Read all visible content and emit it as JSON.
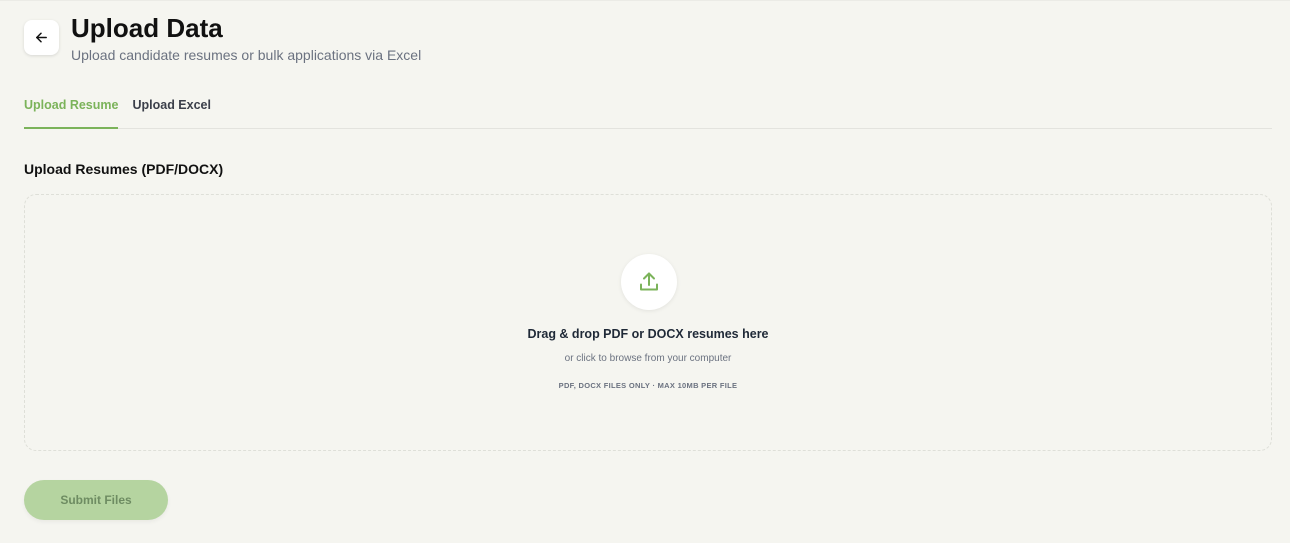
{
  "header": {
    "title": "Upload Data",
    "subtitle": "Upload candidate resumes or bulk applications via Excel",
    "back_icon": "arrow-left-icon"
  },
  "tabs": [
    {
      "label": "Upload Resume",
      "active": true
    },
    {
      "label": "Upload Excel",
      "active": false
    }
  ],
  "section": {
    "title": "Upload Resumes (PDF/DOCX)"
  },
  "dropzone": {
    "icon": "upload-icon",
    "primary_text": "Drag & drop PDF or DOCX resumes here",
    "secondary_text": "or click to browse from your computer",
    "hint_text": "PDF, DOCX FILES ONLY · MAX 10MB PER FILE"
  },
  "actions": {
    "submit_label": "Submit Files"
  },
  "colors": {
    "accent": "#7bb35a",
    "submit_bg": "#b5d4a0",
    "page_bg": "#f5f5f0"
  }
}
